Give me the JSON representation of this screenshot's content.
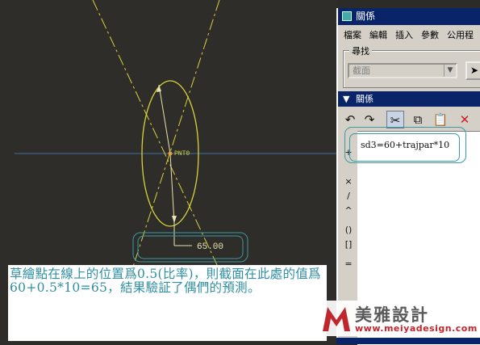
{
  "canvas": {
    "point_label": "PNT0",
    "dimension_value": "65.00",
    "note": "草繪點在線上的位置爲0.5(比率)，則截面在此處的值爲60+0.5*10=65，結果驗証了偶們的預測。"
  },
  "panel": {
    "title": "關係",
    "menu": [
      "檔案",
      "編輯",
      "插入",
      "參數",
      "公用程"
    ],
    "find_label": "尋找",
    "find_select_value": "截面",
    "section_title": "關係",
    "relation_expression": "sd3=60+trajpar*10",
    "side_tools": [
      "+",
      "×",
      "/",
      "^",
      "()",
      "[]",
      "="
    ]
  },
  "logo": {
    "name": "美雅設計",
    "url": "www.meiyadesign.com"
  },
  "colors": {
    "canvas_bg": "#2e2d29",
    "sketch_yellow": "#d8d43a",
    "centerline_blue": "#3a6fa8",
    "highlight_teal": "#3a9aa6",
    "note_text": "#2f8fa2",
    "titlebar": "#0a246a"
  }
}
